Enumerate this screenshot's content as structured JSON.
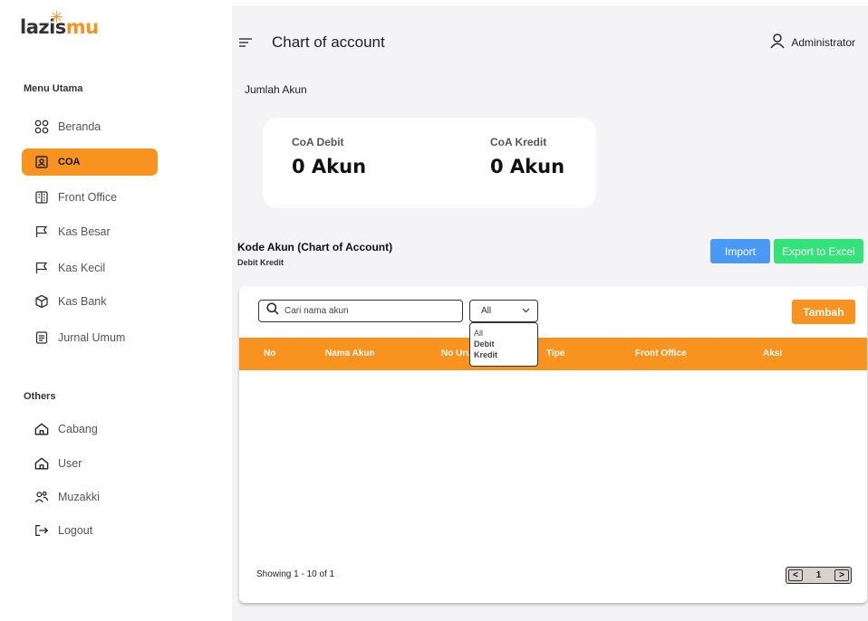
{
  "brand": {
    "logo_text_main": "lazis",
    "logo_text_accent": "mu",
    "accent_color": "#f7931e"
  },
  "sidebar": {
    "section_main": "Menu Utama",
    "main_items": [
      {
        "label": "Beranda",
        "icon": "grid-icon"
      },
      {
        "label": "COA",
        "icon": "id-card-icon",
        "active": true
      },
      {
        "label": "Front Office",
        "icon": "building-icon"
      },
      {
        "label": "Kas Besar",
        "icon": "flag-icon"
      },
      {
        "label": "Kas Kecil",
        "icon": "flag-icon"
      },
      {
        "label": "Kas Bank",
        "icon": "cube-icon"
      },
      {
        "label": "Jurnal Umum",
        "icon": "document-icon"
      }
    ],
    "section_others": "Others",
    "other_items": [
      {
        "label": "Cabang",
        "icon": "home-icon"
      },
      {
        "label": "User",
        "icon": "home-icon"
      },
      {
        "label": "Muzakki",
        "icon": "users-icon"
      },
      {
        "label": "Logout",
        "icon": "logout-icon"
      }
    ]
  },
  "header": {
    "title": "Chart of account",
    "user_name": "Administrator"
  },
  "summary": {
    "heading": "Jumlah Akun",
    "debit_label": "CoA Debit",
    "debit_value": "0 Akun",
    "kredit_label": "CoA Kredit",
    "kredit_value": "0 Akun"
  },
  "section": {
    "title": "Kode Akun (Chart of Account)",
    "subtitle": "Debit Kredit",
    "import_label": "Import",
    "export_label": "Export to Excel"
  },
  "table": {
    "search_placeholder": "Cari nama akun",
    "filter_selected": "All",
    "filter_options": [
      "All",
      "Debit",
      "Kredit"
    ],
    "add_label": "Tambah",
    "columns": [
      "No",
      "Nama Akun",
      "No Urut",
      "Tipe",
      "Front Office",
      "Aksi"
    ],
    "rows": [],
    "showing_text": "Showing 1 - 10 of 1",
    "page_prev": "<",
    "page_current": "1",
    "page_next": ">"
  },
  "colors": {
    "primary": "#f7931e",
    "import": "#4a9af5",
    "export": "#33e37a",
    "background": "#f4f4f6"
  }
}
